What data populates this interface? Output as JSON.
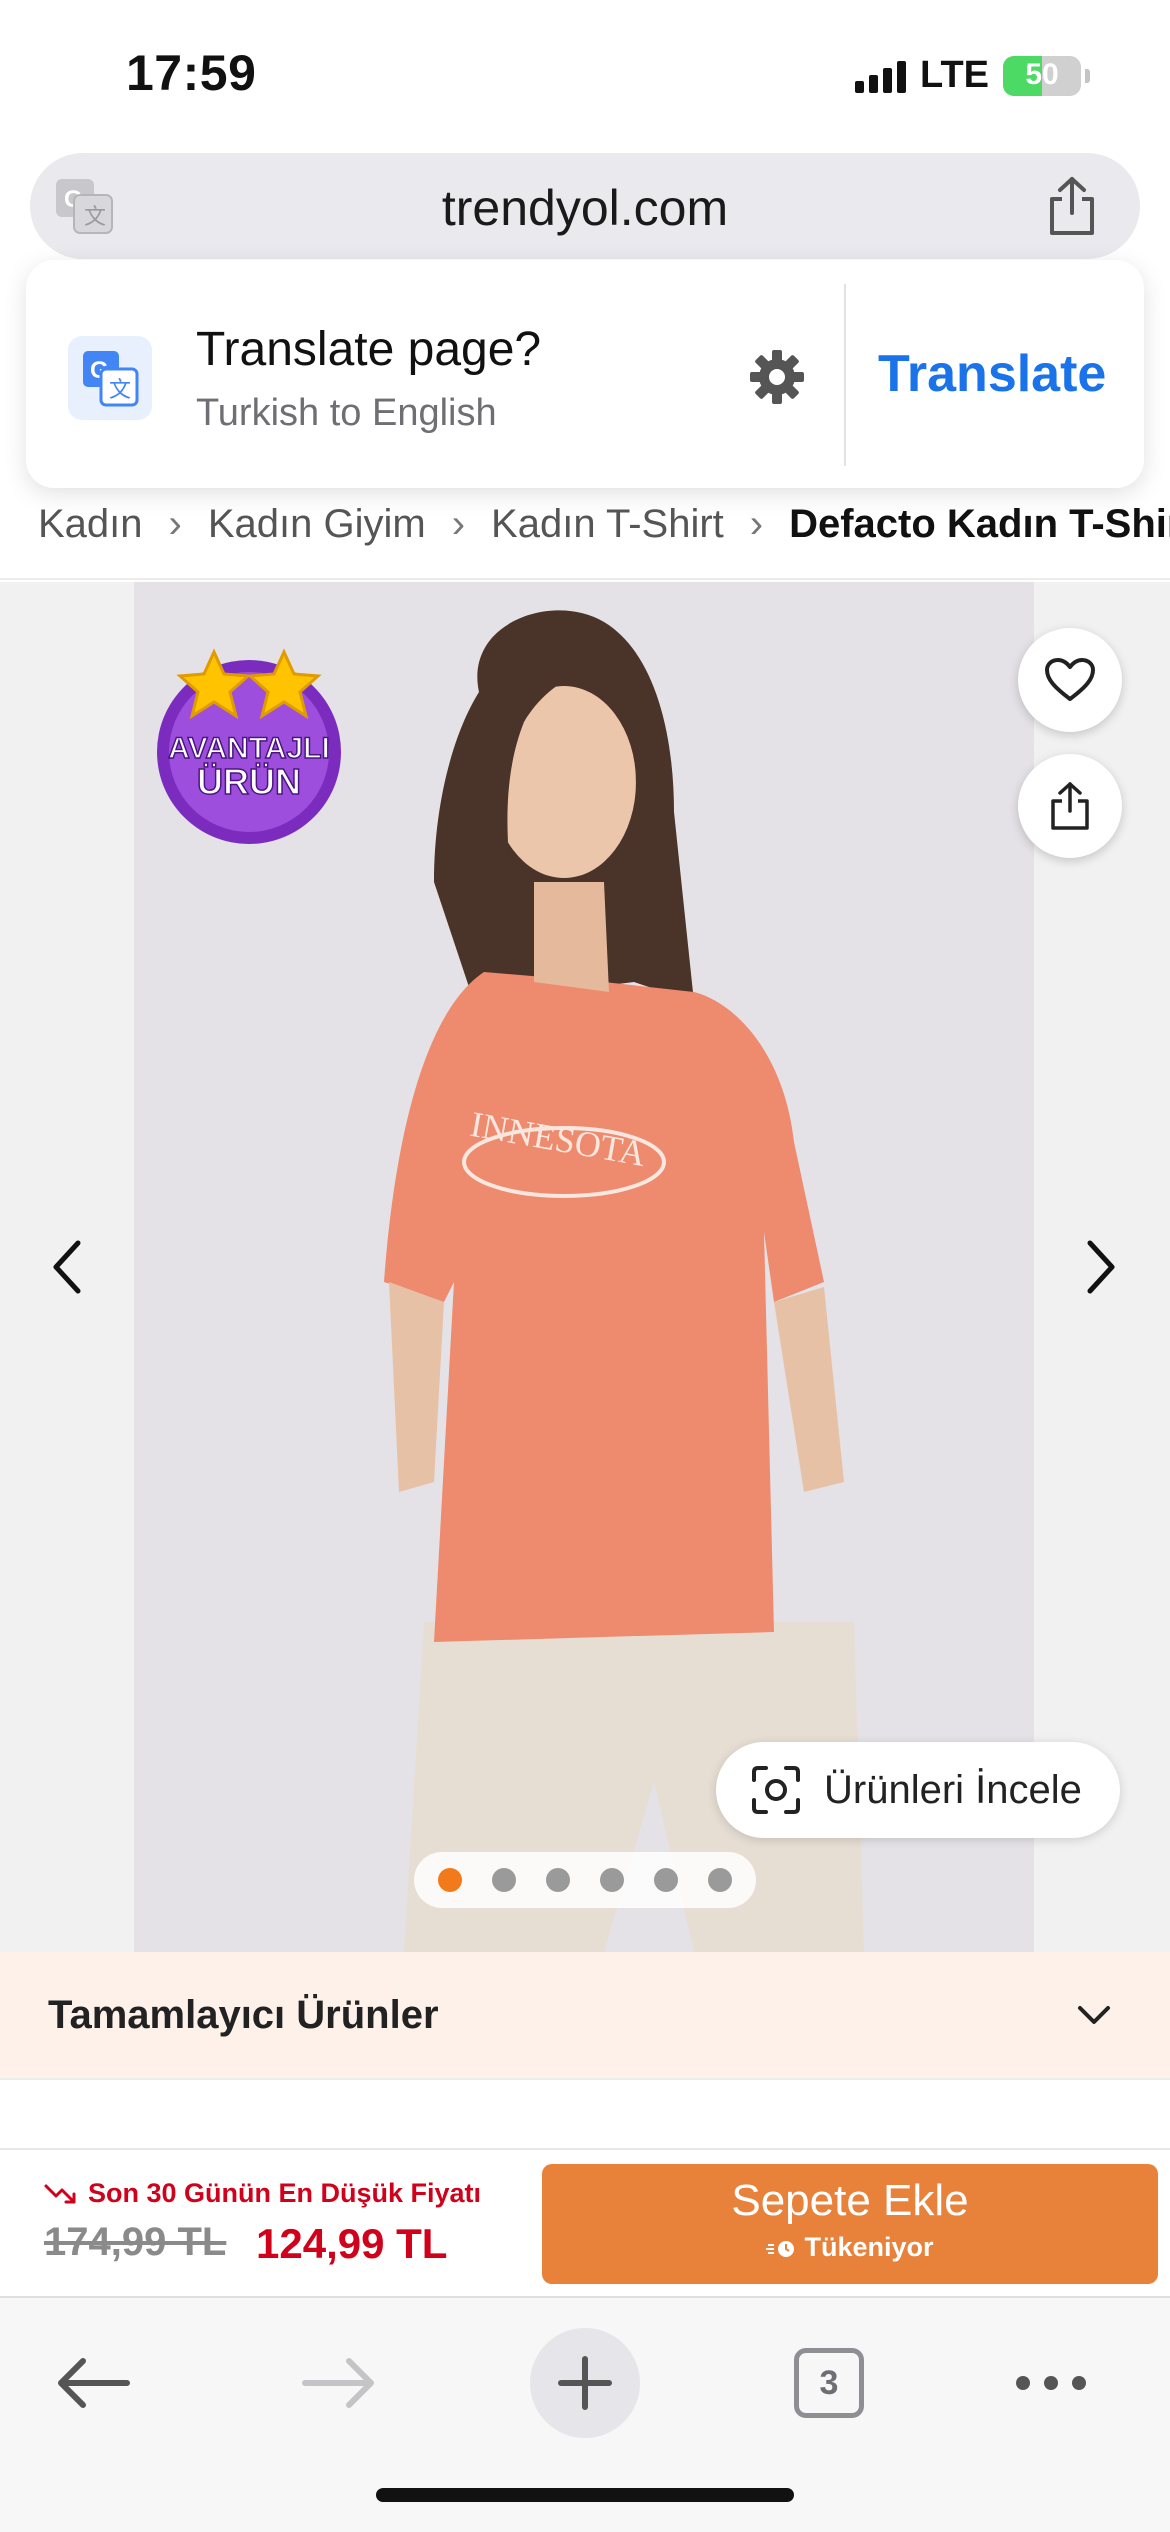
{
  "status_bar": {
    "time": "17:59",
    "network": "LTE",
    "battery_percent": "50",
    "battery_level": 0.5,
    "battery_color": "#4cd964"
  },
  "url_bar": {
    "domain": "trendyol.com",
    "left_icon": "translate-icon",
    "right_icon": "share-icon"
  },
  "translate_popup": {
    "title": "Translate page?",
    "subtitle": "Turkish to English",
    "action": "Translate",
    "icon": "google-translate-icon",
    "settings_icon": "gear-icon",
    "accent_color": "#1a73e8"
  },
  "breadcrumb": {
    "items": [
      "Kadın",
      "Kadın Giyim",
      "Kadın T-Shirt",
      "Defacto Kadın T-Shirt"
    ]
  },
  "gallery": {
    "badge_icon": "avantajli-urun-badge",
    "review_button": "Ürünleri İncele",
    "total_images": 6,
    "active_image": 1,
    "accent_color": "#f27a1a"
  },
  "complementary": {
    "label": "Tamamlayıcı Ürünler"
  },
  "purchase": {
    "lowest_price_note": "Son 30 Günün En Düşük Fiyatı",
    "old_price": "174,99 TL",
    "new_price": "124,99 TL",
    "add_to_cart": "Sepete Ekle",
    "stock_status": "Tükeniyor",
    "button_color": "#e8823b",
    "price_color": "#d0021b"
  },
  "toolbar": {
    "tab_count": "3"
  }
}
